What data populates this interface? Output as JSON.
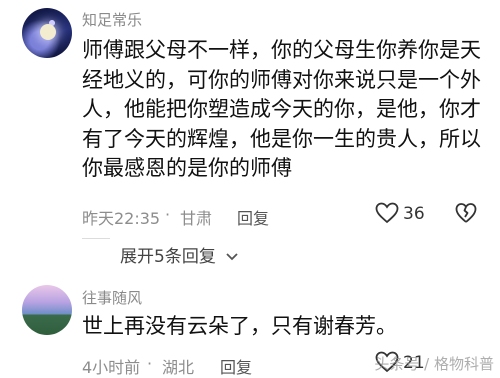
{
  "comments": [
    {
      "username": "知足常乐",
      "lines": [
        "师傅跟父母不一样，你的父母生你养你是天",
        "经地义的，可你的师傅对你来说只是一个外",
        "人，他能把你塑造成今天的你，是他，你才",
        "有了今天的辉煌，他是你一生的贵人，所以",
        "你最感恩的是你的师傅"
      ],
      "time": "昨天22:35",
      "dot": "·",
      "location": "甘肃",
      "reply_label": "回复",
      "likes": "36",
      "avatar_icon": "night-moon-avatar"
    },
    {
      "username": "往事随风",
      "lines": [
        "世上再没有云朵了，只有谢春芳。"
      ],
      "time": "4小时前",
      "dot": "·",
      "location": "湖北",
      "reply_label": "回复",
      "likes": "21",
      "avatar_icon": "landscape-avatar"
    }
  ],
  "expand_replies": "展开5条回复",
  "watermark": "头条号 / 格物科普"
}
